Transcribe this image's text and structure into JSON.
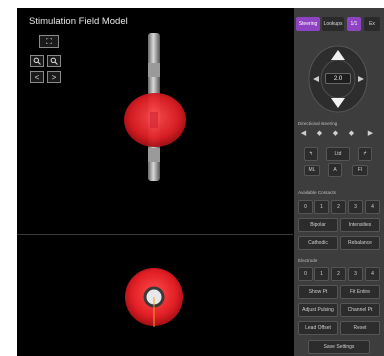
{
  "viewport": {
    "title": "Stimulation Field Model",
    "buttons": [
      {
        "name": "fit-view-button",
        "glyph": "⛶"
      },
      {
        "name": "zoom-in-button",
        "glyph": "🔍︎"
      },
      {
        "name": "zoom-out-button",
        "glyph": "🔍︎"
      },
      {
        "name": "prev-button",
        "glyph": "<"
      },
      {
        "name": "next-button",
        "glyph": ">"
      }
    ]
  },
  "panel": {
    "tabs": [
      {
        "label": "Steering",
        "active": true
      },
      {
        "label": "Lookups",
        "active": false
      },
      {
        "label": "1/1",
        "active": true
      },
      {
        "label": "Ex",
        "active": false
      }
    ],
    "amplitude_value": "2.0",
    "section_directional": "Directional steering",
    "directional_icons": [
      "◀",
      "◆",
      "◆",
      "◆",
      "▶"
    ],
    "rotate_buttons": [
      {
        "label": "↰"
      },
      {
        "label": "Ltd"
      },
      {
        "label": "↱"
      }
    ],
    "small_controls": [
      {
        "label": "ML"
      },
      {
        "label": "A"
      },
      {
        "label": "FI"
      }
    ],
    "section_ring": "Available Contacts",
    "ring_numbers": [
      "0",
      "1",
      "2",
      "3",
      "4"
    ],
    "ring_buttons_row1": [
      "Bipolar",
      "Intensities"
    ],
    "ring_buttons_row2": [
      "Cathodic",
      "Rebalance"
    ],
    "section_settings": "Electrode",
    "settings_numbers": [
      "0",
      "1",
      "2",
      "3",
      "4"
    ],
    "setting_buttons": [
      [
        "Show Pt",
        "Fit Entire"
      ],
      [
        "Adjust Pulsing",
        "Channel Pt"
      ],
      [
        "Lead Offset",
        "Reset"
      ]
    ],
    "footer_button": "Save Settings"
  }
}
